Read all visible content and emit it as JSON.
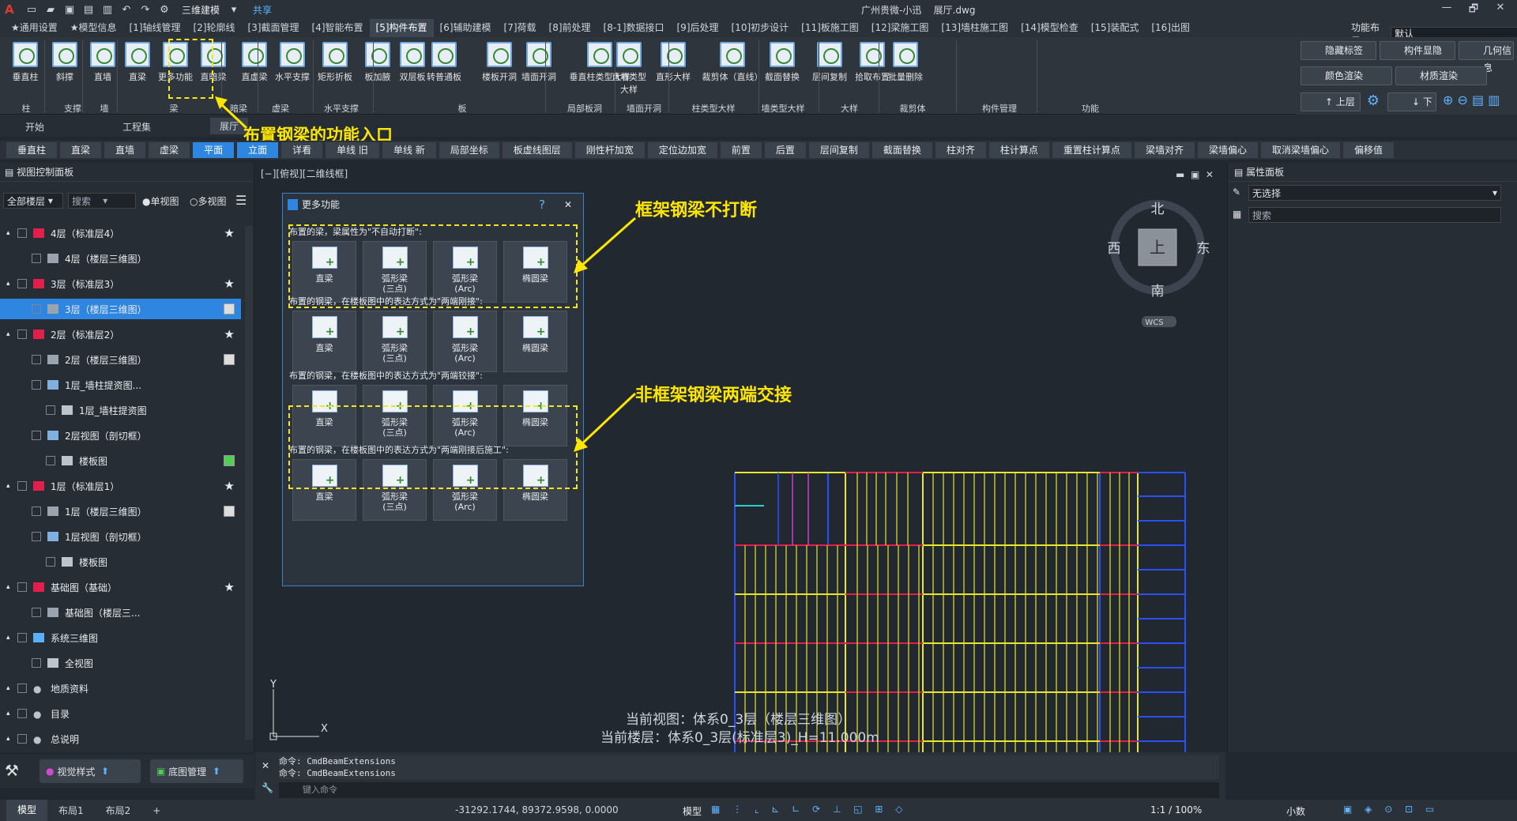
{
  "titlebar": {
    "mode": "三维建模",
    "share": "共享",
    "title": "广州贵微-小迅",
    "file": "展厅.dwg",
    "win": [
      "—",
      "🗗",
      "✕"
    ]
  },
  "menubar": {
    "tabs": [
      "★通用设置",
      "★模型信息",
      "[1]轴线管理",
      "[2]轮廓线",
      "[3]截面管理",
      "[4]智能布置",
      "[5]构件布置",
      "[6]辅助建模",
      "[7]荷载",
      "[8]前处理",
      "[8-1]数据接口",
      "[9]后处理",
      "[10]初步设计",
      "[11]板施工图",
      "[12]梁施工图",
      "[13]墙柱施工图",
      "[14]模型检查",
      "[15]装配式",
      "[16]出图"
    ],
    "active": 6,
    "layout_label": "功能布局:",
    "layout_value": "默认"
  },
  "ribbon": {
    "buttons": [
      "垂直柱",
      "斜撑",
      "直墙",
      "直梁",
      "更多功能",
      "直暗梁",
      "直虚梁",
      "水平支撑",
      "矩形折板",
      "板加腋",
      "双层板",
      "转普通板",
      "楼板开洞",
      "墙面开洞",
      "垂直柱类型大样",
      "直墙类型大样",
      "直形大样",
      "裁剪体（直线）",
      "截面替换",
      "层间复制",
      "拾取布置",
      "批量删除"
    ],
    "groups": [
      "柱",
      "支撑",
      "墙",
      "梁",
      "暗梁",
      "虚梁",
      "水平支撑",
      "板",
      "局部板洞",
      "墙面开洞",
      "柱类型大样",
      "墙类型大样",
      "大样",
      "裁剪体",
      "构件管理",
      "功能"
    ],
    "right": {
      "hide_label": "隐藏标签",
      "component_show": "构件显隐",
      "geo_info": "几何信息",
      "color_render": "颜色渲染",
      "material_render": "材质渲染",
      "up_floor": "上层",
      "down_floor": "下层"
    }
  },
  "subtabs": {
    "items": [
      "开始",
      "工程集",
      "展厅"
    ],
    "active": 2
  },
  "toolbar": {
    "items": [
      "垂直柱",
      "直梁",
      "直墙",
      "虚梁",
      "平面",
      "立面",
      "详看",
      "单线 旧",
      "单线 新",
      "局部坐标",
      "板虚线图层",
      "刚性杆加宽",
      "定位边加宽",
      "前置",
      "后置",
      "层间复制",
      "截面替换",
      "柱对齐",
      "柱计算点",
      "重置柱计算点",
      "梁墙对齐",
      "梁墙偏心",
      "取消梁墙偏心",
      "偏移值"
    ],
    "on": [
      4,
      5
    ]
  },
  "leftpanel": {
    "header": "视图控制面板",
    "floor_select": "全部楼层",
    "search": "搜索",
    "single_view": "单视图",
    "multi_view": "多视图",
    "tree": [
      {
        "label": "4层（标准层4）",
        "level": 0,
        "type": "floor",
        "mark": "star"
      },
      {
        "label": "4层（楼层三维图）",
        "level": 1,
        "type": "view"
      },
      {
        "label": "3层（标准层3）",
        "level": 0,
        "type": "floor",
        "mark": "star"
      },
      {
        "label": "3层（楼层三维图）",
        "level": 1,
        "type": "view",
        "selected": true
      },
      {
        "label": "2层（标准层2）",
        "level": 0,
        "type": "floor",
        "mark": "star"
      },
      {
        "label": "2层（楼层三维图）",
        "level": 1,
        "type": "view",
        "mark": "sq"
      },
      {
        "label": "1层_墙柱提资图...",
        "level": 1,
        "type": "grid"
      },
      {
        "label": "1层_墙柱提资图",
        "level": 2,
        "type": "doc"
      },
      {
        "label": "2层视图（剖切框）",
        "level": 1,
        "type": "grid"
      },
      {
        "label": "楼板图",
        "level": 2,
        "type": "doc",
        "mark": "green"
      },
      {
        "label": "1层（标准层1）",
        "level": 0,
        "type": "floor",
        "mark": "star"
      },
      {
        "label": "1层（楼层三维图）",
        "level": 1,
        "type": "view",
        "mark": "sq"
      },
      {
        "label": "1层视图（剖切框）",
        "level": 1,
        "type": "grid"
      },
      {
        "label": "楼板图",
        "level": 2,
        "type": "doc"
      },
      {
        "label": "基础图（基础）",
        "level": 0,
        "type": "floor",
        "mark": "star"
      },
      {
        "label": "基础图（楼层三...",
        "level": 1,
        "type": "view"
      },
      {
        "label": "系统三维图",
        "level": 0,
        "type": "sys"
      },
      {
        "label": "全视图",
        "level": 1,
        "type": "doc"
      },
      {
        "label": "地质资料",
        "level": 0,
        "type": "dot"
      },
      {
        "label": "目录",
        "level": 0,
        "type": "dot"
      },
      {
        "label": "总说明",
        "level": 0,
        "type": "dot"
      }
    ],
    "bottom": {
      "view_style": "视觉样式",
      "base_mgmt": "底图管理"
    }
  },
  "canvas": {
    "header": "[−][俯视][二维线框]",
    "compass": {
      "n": "北",
      "s": "南",
      "e": "东",
      "w": "西",
      "center": "上",
      "wcs": "WCS"
    },
    "status1": "当前视图：体系0_3层（楼层三维图）",
    "status2": "当前楼层：体系0_3层(标准层3)_H=11.000m",
    "axis_x": "X",
    "axis_y": "Y"
  },
  "dialog": {
    "title": "更多功能",
    "help": "?",
    "close": "✕",
    "sections": [
      {
        "label": "布置的梁，梁属性为\"不自动打断\":",
        "items": [
          "直梁",
          "弧形梁\n(三点)",
          "弧形梁\n(Arc)",
          "椭圆梁"
        ]
      },
      {
        "label": "布置的钢梁，在楼板图中的表达方式为\"两端刚接\":",
        "items": [
          "直梁",
          "弧形梁\n(三点)",
          "弧形梁\n(Arc)",
          "椭圆梁"
        ]
      },
      {
        "label": "布置的钢梁，在楼板图中的表达方式为\"两端铰接\":",
        "items": [
          "直梁",
          "弧形梁\n(三点)",
          "弧形梁\n(Arc)",
          "椭圆梁"
        ]
      },
      {
        "label": "布置的钢梁，在楼板图中的表达方式为\"两端刚接后施工\":",
        "items": [
          "直梁",
          "弧形梁\n(三点)",
          "弧形梁\n(Arc)",
          "椭圆梁"
        ]
      }
    ]
  },
  "annotations": {
    "entry": "布置钢梁的功能入口",
    "frame": "框架钢梁不打断",
    "nonframe": "非框架钢梁两端交接"
  },
  "rightpanel": {
    "header": "属性面板",
    "selection": "无选择",
    "search": "搜索"
  },
  "command": {
    "lines": [
      "命令: CmdBeamExtensions",
      "命令: CmdBeamExtensions"
    ],
    "placeholder": "键入命令"
  },
  "statusbar": {
    "tabs": [
      "模型",
      "布局1",
      "布局2",
      "+"
    ],
    "coords": "-31292.1744, 89372.9598, 0.0000",
    "model": "模型",
    "scale": "1:1 / 100%",
    "decimal": "小数"
  },
  "colors": {
    "accent": "#2f86e0",
    "annotation": "#ffe600",
    "beam_yellow": "#e6e62c",
    "beam_blue": "#2b4fff",
    "beam_red": "#e0204a"
  }
}
